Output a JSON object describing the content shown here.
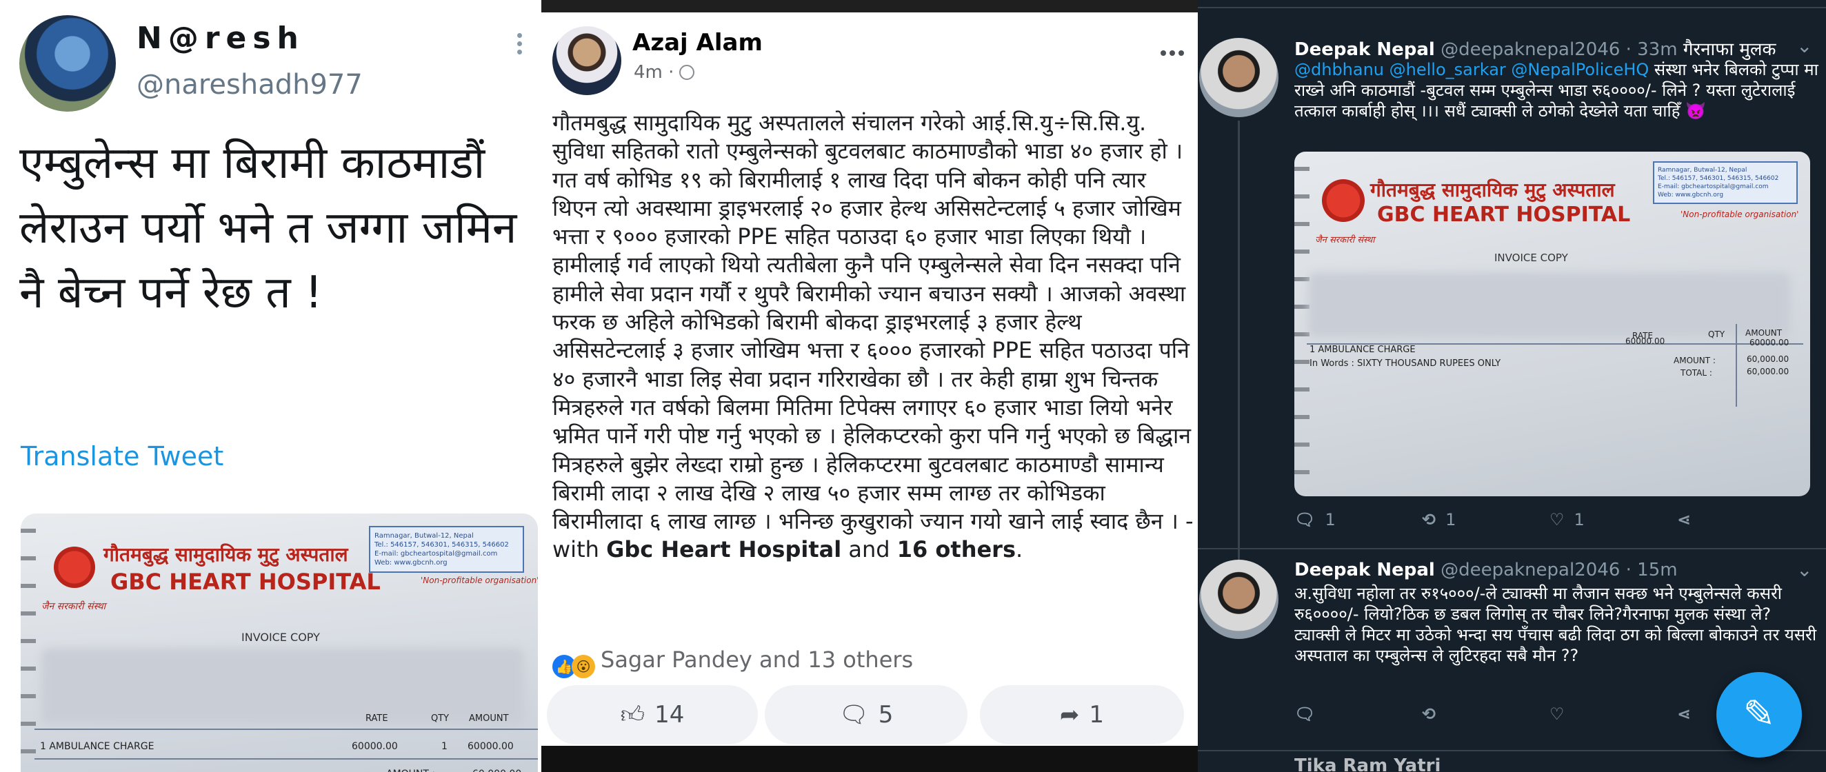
{
  "panel1": {
    "name": "N@resh",
    "handle": "@nareshadh977",
    "tweet_text": "एम्बुलेन्स मा बिरामी काठमाडौं लेराउन पर्यो भने त जग्गा जमिन नै बेच्न पर्ने रेछ त !",
    "translate": "Translate Tweet",
    "icons": [
      "more-vertical-icon"
    ]
  },
  "receipt": {
    "hospital_np": "गौतमबुद्ध सामुदायिक मुटु अस्पताल",
    "hospital_en": "GBC HEART HOSPITAL",
    "address": "Ramnagar, Butwal-12, Nepal\nTel.: 546157, 546301, 546315, 546602\nE-mail: gbcheartospital@gmail.com\nWeb: www.gbcnh.org",
    "address_short": "Ramnagar, Butwal-12, Nepal\nTel.: 546157, 546301, 546315, 546602\nE-mail: gbcheartospital@gmail.com\nWeb: www.gbcnh.org",
    "tagline_np": "जैन सरकारी संस्था",
    "nonprofit": "'Non-profitable organisation'",
    "invoice": "INVOICE COPY",
    "col_rate": "RATE",
    "col_qty": "QTY",
    "col_amount": "AMOUNT",
    "item": "1   AMBULANCE CHARGE",
    "rate": "60000.00",
    "qty": "1",
    "amount": "60000.00",
    "amount_label": "AMOUNT :",
    "amount_total": "60,000.00",
    "total_label": "TOTAL :",
    "total_value": "60,000.00",
    "words": "In Words :  SIXTY THOUSAND  RUPEES ONLY"
  },
  "panel2": {
    "name": "Azaj Alam",
    "meta": "4m ·",
    "body": "गौतमबुद्ध सामुदायिक मुटु अस्पतालले संचालन गरेको आई.सि.यु÷सि.सि.यु. सुविधा सहितको रातो एम्बुलेन्सको बुटवलबाट काठमाण्डौको भाडा ४० हजार हो । गत वर्ष कोभिड १९ को बिरामीलाई १ लाख दिदा पनि बोकन कोही पनि त्यार थिएन त्यो अवस्थामा ड्राइभरलाई २० हजार हेल्थ असिसटेन्टलाई ५ हजार जोखिम भत्ता र ९००० हजारको PPE सहित पठाउदा ६० हजार भाडा लिएका थियौ । हामीलाई गर्व लाएको थियो त्यतीबेला कुनै पनि एम्बुलेन्सले सेवा दिन नसक्दा पनि हामीले सेवा प्रदान गर्यौ र थुपरै बिरामीको ज्यान बचाउन सक्यौ । आजको अवस्था फरक छ अहिले कोभिडको बिरामी बोकदा ड्राइभरलाई ३ हजार हेल्थ असिसटेन्टलाई ३ हजार जोखिम भत्ता र ६००० हजारको PPE सहित पठाउदा पनि ४० हजारनै भाडा लिइ सेवा प्रदान गरिराखेका छौ । तर केही हाम्रा शुभ चिन्तक मित्रहरुले गत वर्षको बिलमा मितिमा टिपेक्स लगाएर ६० हजार भाडा लियो भनेर भ्रमित पार्ने गरी पोष्ट गर्नु भएको छ । हेलिकप्टरको कुरा पनि गर्नु भएको छ बिद्धान मित्रहरुले बुझेर लेख्दा राम्रो हुन्छ । हेलिकप्टरमा बुटवलबाट काठमाण्डौ सामान्य बिरामी लादा २ लाख देखि २ लाख ५० हजार सम्म लाग्छ तर कोभिडका बिरामीलादा ६ लाख लाग्छ । भनिन्छ कुखुराको ज्यान गयो खाने लाई स्वाद छैन । - with",
    "tag1": "Gbc Heart Hospital",
    "and": "and",
    "tag2": "16 others",
    "period": ".",
    "reacts_text": "Sagar Pandey and 13 others",
    "like_count": "14",
    "comment_count": "5",
    "share_count": "1",
    "icons": [
      "globe-icon",
      "more-horizontal-icon",
      "like-icon",
      "comment-icon",
      "share-icon"
    ]
  },
  "panel3": {
    "tweet1": {
      "name": "Deepak Nepal",
      "handle": "@deepaknepal2046 · 33m",
      "head_text": "गैरनाफा मुलक",
      "mentions": "@dhbhanu @hello_sarkar @NepalPoliceHQ",
      "text": "संस्था भनेर बिलको टुप्पा मा राख्ने अनि काठमाडौं -बुटवल सम्म एम्बुलेन्स भाडा रु६००००/- लिने ? यस्ता लुटेरालाई तत्काल कार्बाही होस् ।।। सधैं ट्याक्सी ले ठगेको देख्नेले यता चाहिँ 👿",
      "replies": "1",
      "retweets": "1",
      "likes": "1"
    },
    "tweet2": {
      "name": "Deepak Nepal",
      "handle": "@deepaknepal2046 · 15m",
      "text": "अ.सुविधा नहोला तर रु१५०००/-ले ट्याक्सी मा लैजान सक्छ भने एम्बुलेन्सले कसरी रु६००००/- लियो?ठिक छ डबल लिगोस् तर चौबर लिने?गैरनाफा मुलक संस्था ले? ट्याक्सी ले मिटर मा उठेको भन्दा सय पँचास बढी लिदा ठग को बिल्ला बोकाउने तर यसरी अस्पताल का एम्बुलेन्स ले लुटिरहदा सबै मौन ??"
    },
    "next_name": "Tika Ram Yatri",
    "icons": [
      "chevron-down-icon",
      "reply-icon",
      "retweet-icon",
      "heart-icon",
      "share-icon",
      "compose-icon"
    ]
  },
  "colors": {
    "twitter_blue": "#1da1f2",
    "fb_blue": "#1877f2",
    "dark_bg": "#15202b",
    "hospital_red": "#b8231a"
  }
}
